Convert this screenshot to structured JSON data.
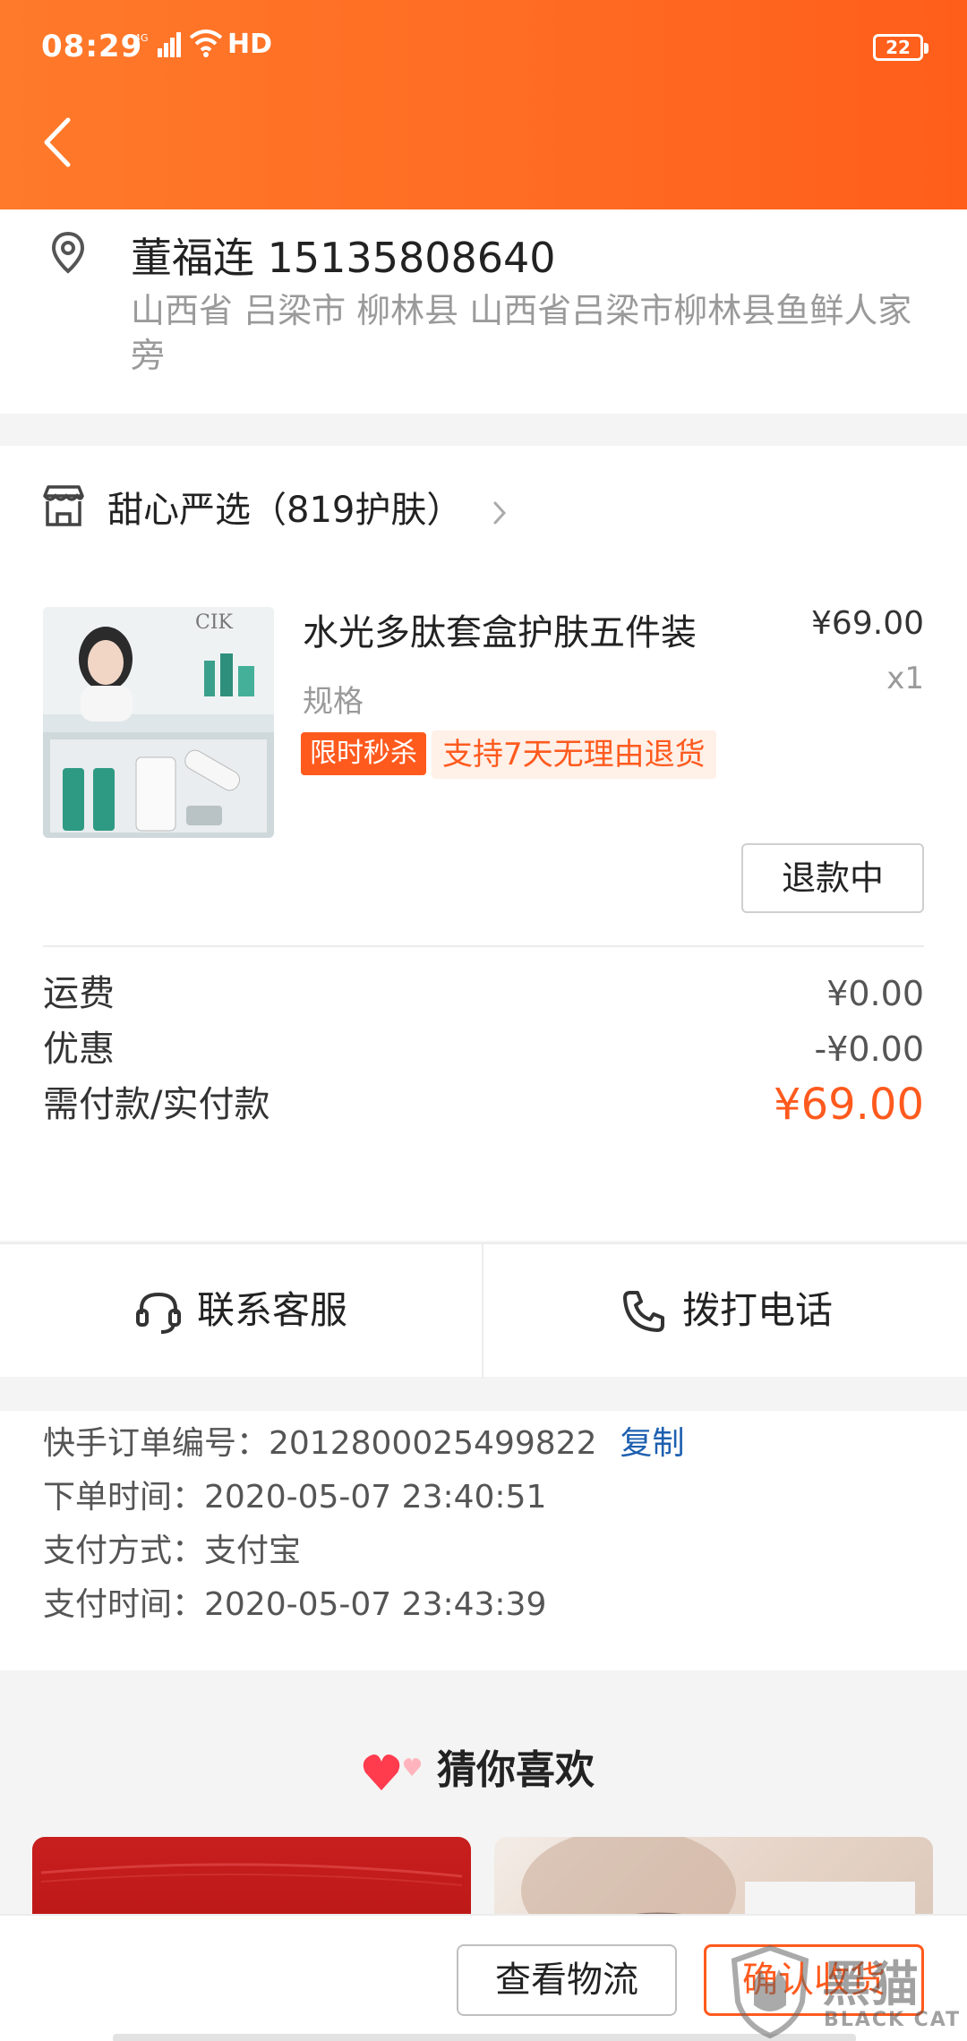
{
  "status_bar": {
    "time": "08:29",
    "signal_label": "4G",
    "hd_label": "HD",
    "battery": "22"
  },
  "address": {
    "name_phone": "董福连 15135808640",
    "detail": "山西省 吕梁市 柳林县 山西省吕梁市柳林县鱼鲜人家旁"
  },
  "shop": {
    "name": "甜心严选（819护肤）"
  },
  "product": {
    "title": "水光多肽套盒护肤五件装",
    "price": "¥69.00",
    "qty": "x1",
    "spec": "规格",
    "tag_flash": "限时秒杀",
    "tag_return": "支持7天无理由退货",
    "refund_button": "退款中",
    "image_brand": "CIK"
  },
  "fees": {
    "shipping_label": "运费",
    "shipping_value": "¥0.00",
    "discount_label": "优惠",
    "discount_value": "-¥0.00",
    "total_label": "需付款/实付款",
    "total_value": "¥69.00"
  },
  "actions": {
    "service_label": "联系客服",
    "call_label": "拨打电话"
  },
  "order_info": {
    "order_no": "快手订单编号：2012800025499822",
    "copy_label": "复制",
    "order_time": "下单时间：2020-05-07 23:40:51",
    "pay_method": "支付方式：支付宝",
    "pay_time": "支付时间：2020-05-07 23:43:39"
  },
  "recommend": {
    "title": "猜你喜欢"
  },
  "bottom_bar": {
    "logistics_label": "查看物流",
    "confirm_label": "确认收货"
  },
  "watermark": {
    "cn": "黑猫",
    "en": "BLACK CAT"
  },
  "colors": {
    "header": "#ff6a22",
    "accent": "#ff5a1e",
    "link": "#1d5fb0"
  }
}
